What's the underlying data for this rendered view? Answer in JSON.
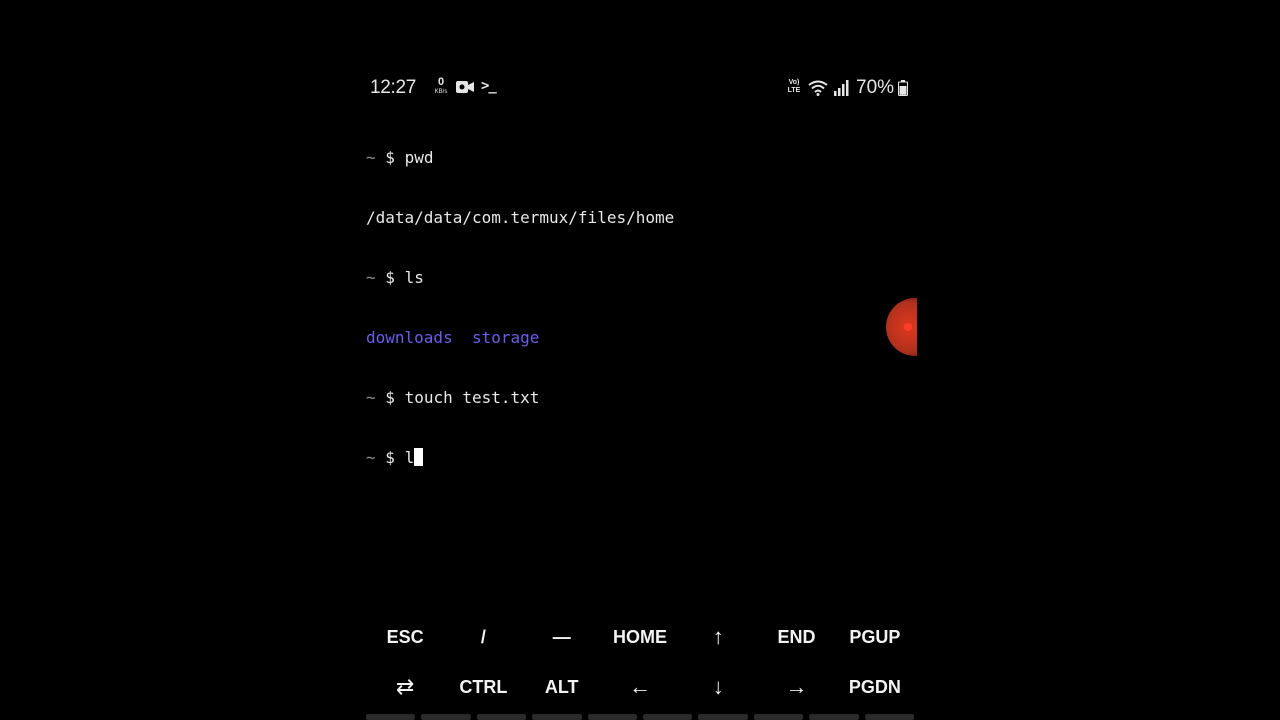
{
  "status_bar": {
    "time": "12:27",
    "net_speed_value": "0",
    "net_speed_unit": "KB/s",
    "notification_icons": [
      "video-camera-icon",
      "terminal-icon"
    ],
    "terminal_glyph": ">_",
    "volte_top": "Vo)",
    "volte_bottom": "LTE",
    "battery_percent": "70%"
  },
  "terminal": {
    "prompt_symbol": "~",
    "prompt_dollar": "$",
    "lines": [
      {
        "type": "command",
        "text": "pwd"
      },
      {
        "type": "output",
        "text": "/data/data/com.termux/files/home"
      },
      {
        "type": "command",
        "text": "ls"
      },
      {
        "type": "dirs",
        "items": [
          "downloads",
          "storage"
        ]
      },
      {
        "type": "command",
        "text": "touch test.txt"
      },
      {
        "type": "command",
        "text": "l"
      }
    ],
    "dir_color": "#6a5cf0"
  },
  "extra_keys": {
    "row1": [
      "ESC",
      "/",
      "—",
      "HOME",
      "↑",
      "END",
      "PGUP"
    ],
    "row2": [
      "⇄",
      "CTRL",
      "ALT",
      "←",
      "↓",
      "→",
      "PGDN"
    ]
  },
  "colors": {
    "background": "#000000",
    "text": "#e8e8e8",
    "record_button": "#e0381f"
  }
}
